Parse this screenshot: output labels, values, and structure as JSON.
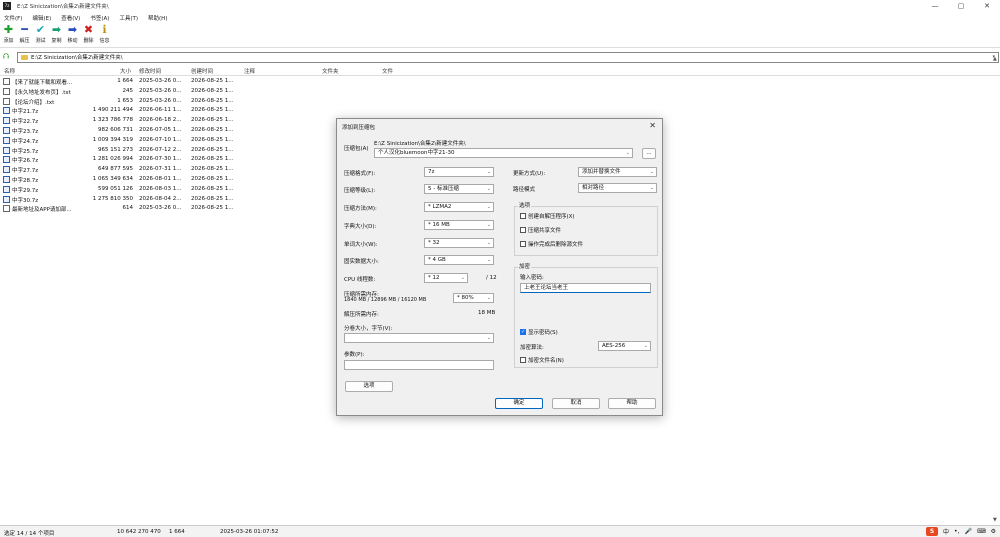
{
  "window": {
    "title": "E:\\Z Sinicization\\合集2\\新建文件夹\\",
    "app_icon_label": "7z",
    "controls": [
      "—",
      "▢",
      "✕"
    ]
  },
  "menubar": [
    "文件(F)",
    "编辑(E)",
    "查看(V)",
    "书签(A)",
    "工具(T)",
    "帮助(H)"
  ],
  "toolbar": [
    {
      "label": "添加",
      "icon": "plus-icon",
      "glyph": "✚",
      "color": "#1e9e2e"
    },
    {
      "label": "解压",
      "icon": "minus-icon",
      "glyph": "━",
      "color": "#2b4fb8"
    },
    {
      "label": "测试",
      "icon": "check-icon",
      "glyph": "✔",
      "color": "#1fa3b8"
    },
    {
      "label": "复制",
      "icon": "copy-arrow-icon",
      "glyph": "➡",
      "color": "#1e9e6e"
    },
    {
      "label": "移动",
      "icon": "move-arrow-icon",
      "glyph": "➡",
      "color": "#2b4fb8"
    },
    {
      "label": "删除",
      "icon": "delete-x-icon",
      "glyph": "✖",
      "color": "#d02020"
    },
    {
      "label": "信息",
      "icon": "info-icon",
      "glyph": "ℹ",
      "color": "#b8960a"
    }
  ],
  "address": {
    "path": "E:\\Z Sinicization\\合集2\\新建文件夹\\"
  },
  "columns": {
    "name": "名称",
    "size": "大小",
    "modified": "修改时间",
    "created": "创建时间",
    "comment": "注释",
    "folders": "文件夹",
    "files": "文件"
  },
  "files": [
    {
      "name": "【来了就能下载和观看...",
      "size": "1 664",
      "modified": "2025-03-26 0...",
      "created": "2026-08-25 1...",
      "zip": false
    },
    {
      "name": "【永久地址发布页】.txt",
      "size": "245",
      "modified": "2025-03-26 0...",
      "created": "2026-08-25 1...",
      "zip": false
    },
    {
      "name": "【论坛介绍】.txt",
      "size": "1 653",
      "modified": "2025-03-26 0...",
      "created": "2026-08-25 1...",
      "zip": false
    },
    {
      "name": "中字21.7z",
      "size": "1 490 211 494",
      "modified": "2026-06-11 1...",
      "created": "2026-08-25 1...",
      "zip": true
    },
    {
      "name": "中字22.7z",
      "size": "1 323 786 778",
      "modified": "2026-06-18 2...",
      "created": "2026-08-25 1...",
      "zip": true
    },
    {
      "name": "中字23.7z",
      "size": "982 606 731",
      "modified": "2026-07-05 1...",
      "created": "2026-08-25 1...",
      "zip": true
    },
    {
      "name": "中字24.7z",
      "size": "1 009 394 319",
      "modified": "2026-07-10 1...",
      "created": "2026-08-25 1...",
      "zip": true
    },
    {
      "name": "中字25.7z",
      "size": "965 151 273",
      "modified": "2026-07-12 2...",
      "created": "2026-08-25 1...",
      "zip": true
    },
    {
      "name": "中字26.7z",
      "size": "1 281 026 994",
      "modified": "2026-07-30 1...",
      "created": "2026-08-25 1...",
      "zip": true
    },
    {
      "name": "中字27.7z",
      "size": "649 877 595",
      "modified": "2026-07-31 1...",
      "created": "2026-08-25 1...",
      "zip": true
    },
    {
      "name": "中字28.7z",
      "size": "1 065 349 634",
      "modified": "2026-08-01 1...",
      "created": "2026-08-25 1...",
      "zip": true
    },
    {
      "name": "中字29.7z",
      "size": "599 051 126",
      "modified": "2026-08-03 1...",
      "created": "2026-08-25 1...",
      "zip": true
    },
    {
      "name": "中字30.7z",
      "size": "1 275 810 350",
      "modified": "2026-08-04 2...",
      "created": "2026-08-25 1...",
      "zip": true
    },
    {
      "name": "最新地址及APP请加部...",
      "size": "614",
      "modified": "2025-03-26 0...",
      "created": "2026-08-25 1...",
      "zip": false
    }
  ],
  "status": {
    "selection": "选定 14 / 14 个项目",
    "total_size": "10 642 270 470",
    "selected_size": "1 664",
    "datetime": "2025-03-26 01:07:52"
  },
  "tray": [
    "中",
    "•,",
    "🎤",
    "⌨",
    "⚙"
  ],
  "dialog": {
    "title": "添加到压缩包",
    "close": "✕",
    "archive_label": "压缩包(A)",
    "archive_dir": "E:\\Z Sinicization\\合集2\\新建文件夹\\",
    "archive_name": "个人汉化bluemoon中字21-30",
    "browse": "...",
    "format_label": "压缩格式(F):",
    "format_value": "7z",
    "level_label": "压缩等级(L):",
    "level_value": "5 - 标准压缩",
    "method_label": "压缩方法(M):",
    "method_value": "* LZMA2",
    "dict_label": "字典大小(D):",
    "dict_value": "* 16 MB",
    "word_label": "单词大小(W):",
    "word_value": "* 32",
    "solid_label": "固实数据大小:",
    "solid_value": "* 4 GB",
    "cpu_label": "CPU 线程数:",
    "cpu_value": "* 12",
    "cpu_total": "/ 12",
    "mem_label": "压缩所需内存:",
    "mem_detail": "1840 MB / 12896 MB / 16120 MB",
    "mem_pct": "* 80%",
    "decomp_label": "解压所需内存:",
    "decomp_value": "18 MB",
    "split_label": "分卷大小，字节(V):",
    "params_label": "参数(P):",
    "options_btn": "选项",
    "update_label": "更新方式(U):",
    "update_value": "添加并替换文件",
    "path_label": "路径模式",
    "path_value": "相对路径",
    "opts_title": "选项",
    "opt_sfx": "创建自解压程序(X)",
    "opt_shared": "压缩共享文件",
    "opt_delete": "操作完成后删除源文件",
    "enc_title": "加密",
    "pwd_label": "输入密码:",
    "pwd_value": "上老王论坛当老王",
    "show_pwd": "显示密码(S)",
    "enc_method_label": "加密算法:",
    "enc_method_value": "AES-256",
    "enc_names": "加密文件名(N)",
    "ok": "确定",
    "cancel": "取消",
    "help": "帮助",
    "check": "✓"
  }
}
